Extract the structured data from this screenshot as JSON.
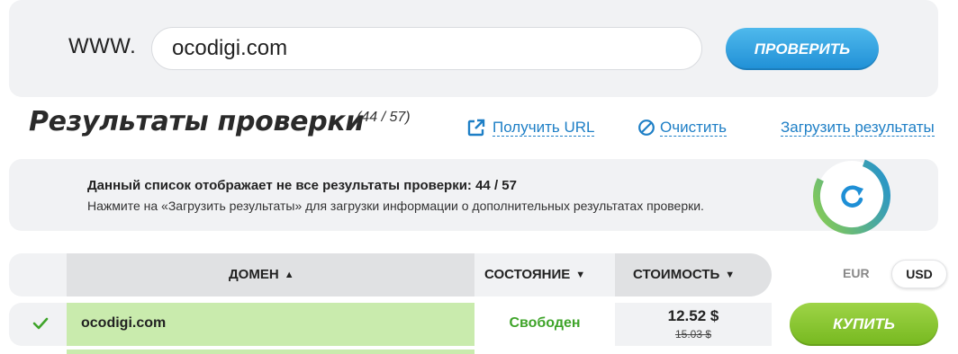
{
  "search": {
    "prefix": "WWW.",
    "value": "ocodigi.com",
    "button_label": "ПРОВЕРИТЬ"
  },
  "results": {
    "title": "Результаты проверки",
    "count": "(44 / 57)",
    "get_url_label": "Получить URL",
    "clear_label": "Очистить",
    "load_label": "Загрузить результаты"
  },
  "notice": {
    "title": "Данный список отображает не все результаты проверки: 44 / 57",
    "text": "Нажмите на «Загрузить результаты» для загрузки информации о дополнительных результатах проверки.",
    "progress": 0.77
  },
  "table": {
    "columns": {
      "domain": "ДОМЕН",
      "status": "СОСТОЯНИЕ",
      "price": "СТОИМОСТЬ"
    },
    "currencies": [
      "EUR",
      "USD"
    ],
    "selected_currency": "USD",
    "rows": [
      {
        "domain": "ocodigi.com",
        "status": "Свободен",
        "price": "12.52 $",
        "old_price": "15.03 $",
        "buy_label": "КУПИТЬ"
      }
    ]
  },
  "colors": {
    "accent_blue": "#1e7fc6",
    "available_green": "#3fa42a",
    "row_highlight": "#c9ebad"
  },
  "icons": [
    "external-link-icon",
    "clear-icon",
    "refresh-icon",
    "sort-icon",
    "dropdown-icon",
    "checkmark-icon"
  ]
}
